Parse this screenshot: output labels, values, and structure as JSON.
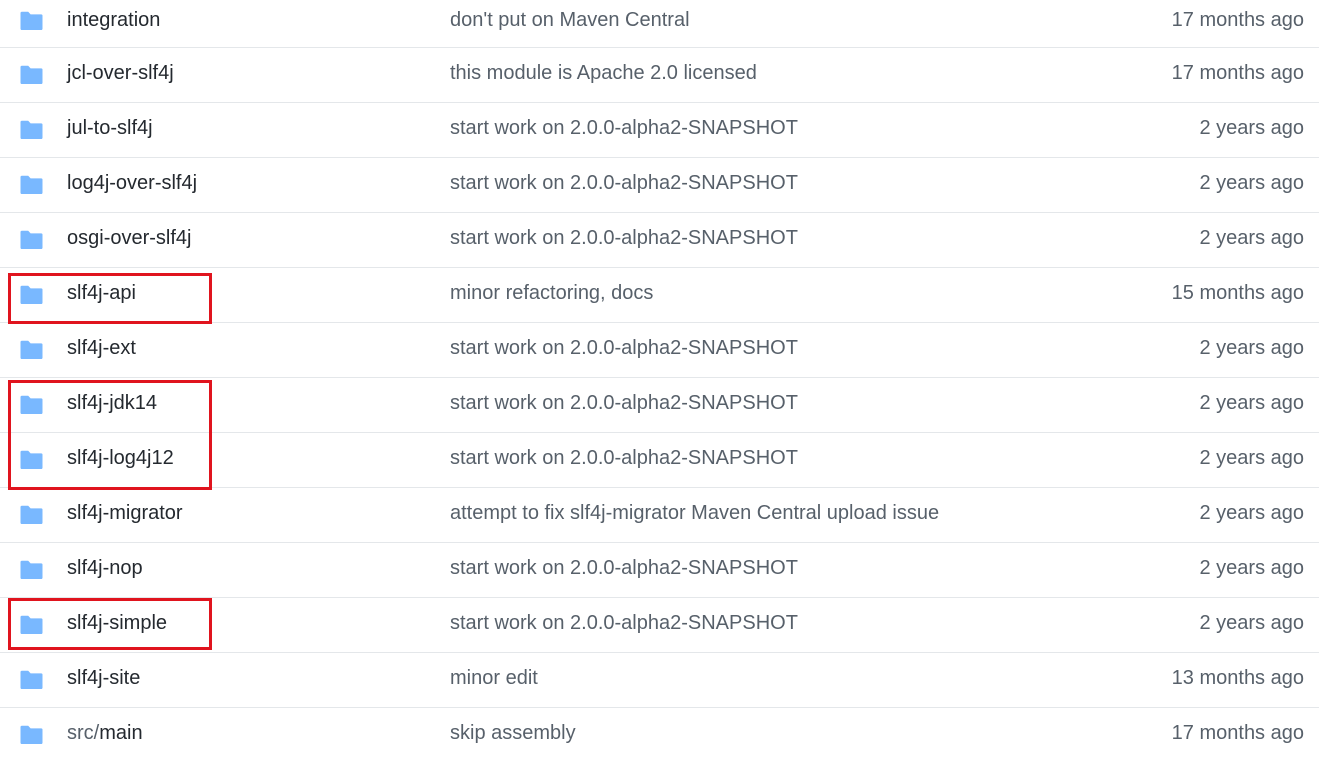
{
  "colors": {
    "folder_icon": "#79b8ff",
    "highlight_box": "#e0141e",
    "row_divider": "#e4e7ea",
    "name_text": "#24292f",
    "muted_text": "#57606a"
  },
  "icons": {
    "folder": "folder-icon"
  },
  "files": [
    {
      "name": "integration",
      "message": "don't put on Maven Central",
      "age": "17 months ago"
    },
    {
      "name": "jcl-over-slf4j",
      "message": "this module is Apache 2.0 licensed",
      "age": "17 months ago"
    },
    {
      "name": "jul-to-slf4j",
      "message": "start work on 2.0.0-alpha2-SNAPSHOT",
      "age": "2 years ago"
    },
    {
      "name": "log4j-over-slf4j",
      "message": "start work on 2.0.0-alpha2-SNAPSHOT",
      "age": "2 years ago"
    },
    {
      "name": "osgi-over-slf4j",
      "message": "start work on 2.0.0-alpha2-SNAPSHOT",
      "age": "2 years ago"
    },
    {
      "name": "slf4j-api",
      "message": "minor refactoring, docs",
      "age": "15 months ago"
    },
    {
      "name": "slf4j-ext",
      "message": "start work on 2.0.0-alpha2-SNAPSHOT",
      "age": "2 years ago"
    },
    {
      "name": "slf4j-jdk14",
      "message": "start work on 2.0.0-alpha2-SNAPSHOT",
      "age": "2 years ago"
    },
    {
      "name": "slf4j-log4j12",
      "message": "start work on 2.0.0-alpha2-SNAPSHOT",
      "age": "2 years ago"
    },
    {
      "name": "slf4j-migrator",
      "message": "attempt to fix slf4j-migrator Maven Central upload issue",
      "age": "2 years ago"
    },
    {
      "name": "slf4j-nop",
      "message": "start work on 2.0.0-alpha2-SNAPSHOT",
      "age": "2 years ago"
    },
    {
      "name": "slf4j-simple",
      "message": "start work on 2.0.0-alpha2-SNAPSHOT",
      "age": "2 years ago"
    },
    {
      "name": "slf4j-site",
      "message": "minor edit",
      "age": "13 months ago"
    },
    {
      "name_prefix": "src/",
      "name": "main",
      "message": "skip assembly",
      "age": "17 months ago"
    }
  ]
}
